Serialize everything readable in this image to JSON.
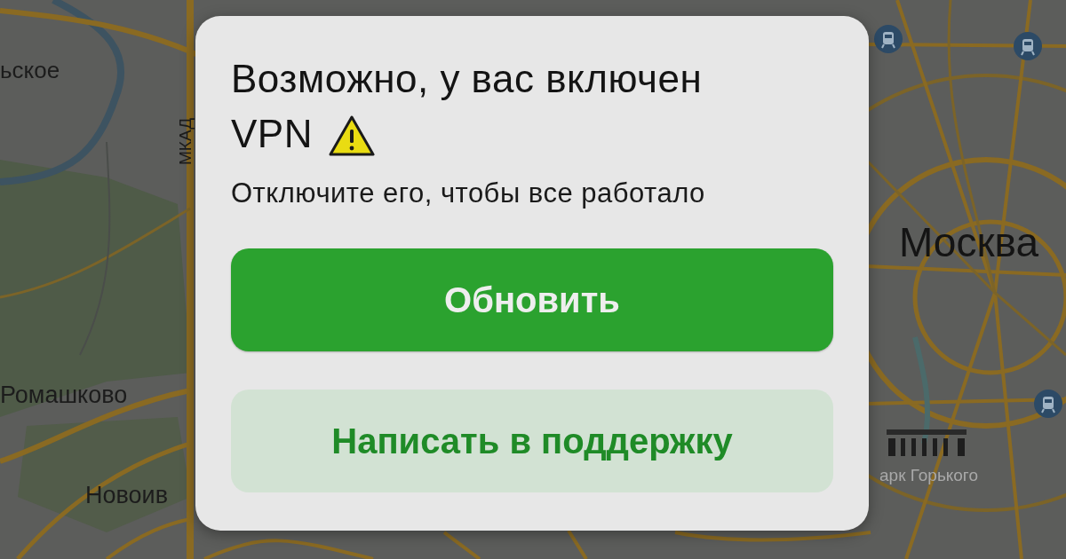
{
  "map": {
    "labels": [
      {
        "text": "ьское"
      },
      {
        "text": "МКАД"
      },
      {
        "text": "Ромашково"
      },
      {
        "text": "Новоив"
      },
      {
        "text": "Москва"
      },
      {
        "text": "арк Горького"
      }
    ]
  },
  "dialog": {
    "title_lines": [
      "Возможно, у вас включен",
      "VPN"
    ],
    "message": "Отключите его, чтобы все работало",
    "buttons": [
      {
        "label": "Обновить",
        "kind": "primary"
      },
      {
        "label": "Написать в поддержку",
        "kind": "secondary"
      }
    ]
  }
}
